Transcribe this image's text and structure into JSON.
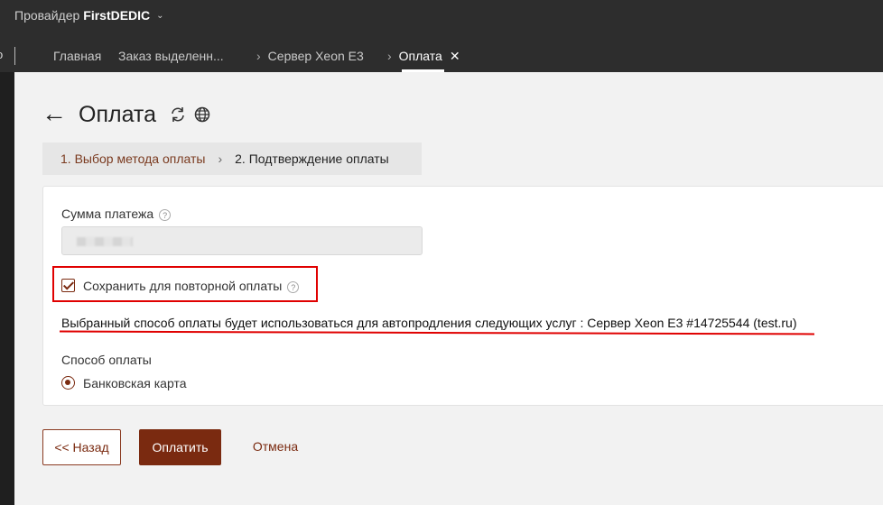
{
  "header": {
    "provider_prefix": "Провайдер",
    "provider_name": "FirstDEDIC",
    "left_cut": "o"
  },
  "tabs": [
    {
      "label": "Главная"
    },
    {
      "label": "Заказ выделенн..."
    },
    {
      "label": "Сервер Xeon E3"
    },
    {
      "label": "Оплата",
      "active": true,
      "close": "✕"
    }
  ],
  "page": {
    "back_arrow": "←",
    "title": "Оплата",
    "icons": [
      "refresh-icon",
      "globe-icon"
    ]
  },
  "steps": {
    "step1": "1. Выбор метода оплаты",
    "separator": "›",
    "step2": "2. Подтверждение оплаты"
  },
  "form": {
    "amount_label": "Сумма платежа",
    "help_glyph": "?",
    "save_label": "Сохранить для повторной оплаты",
    "save_checked": true,
    "info_text": "Выбранный способ оплаты будет использоваться для автопродления следующих услуг : Сервер Xeon E3 #14725544 (test.ru)",
    "payment_method_label": "Способ оплаты",
    "payment_option": "Банковская карта",
    "payment_selected": true
  },
  "buttons": {
    "back": "<< Назад",
    "pay": "Оплатить",
    "cancel": "Отмена"
  },
  "colors": {
    "accent": "#7a2a10",
    "header_bg": "#2d2d2d",
    "highlight": "#e00000"
  }
}
